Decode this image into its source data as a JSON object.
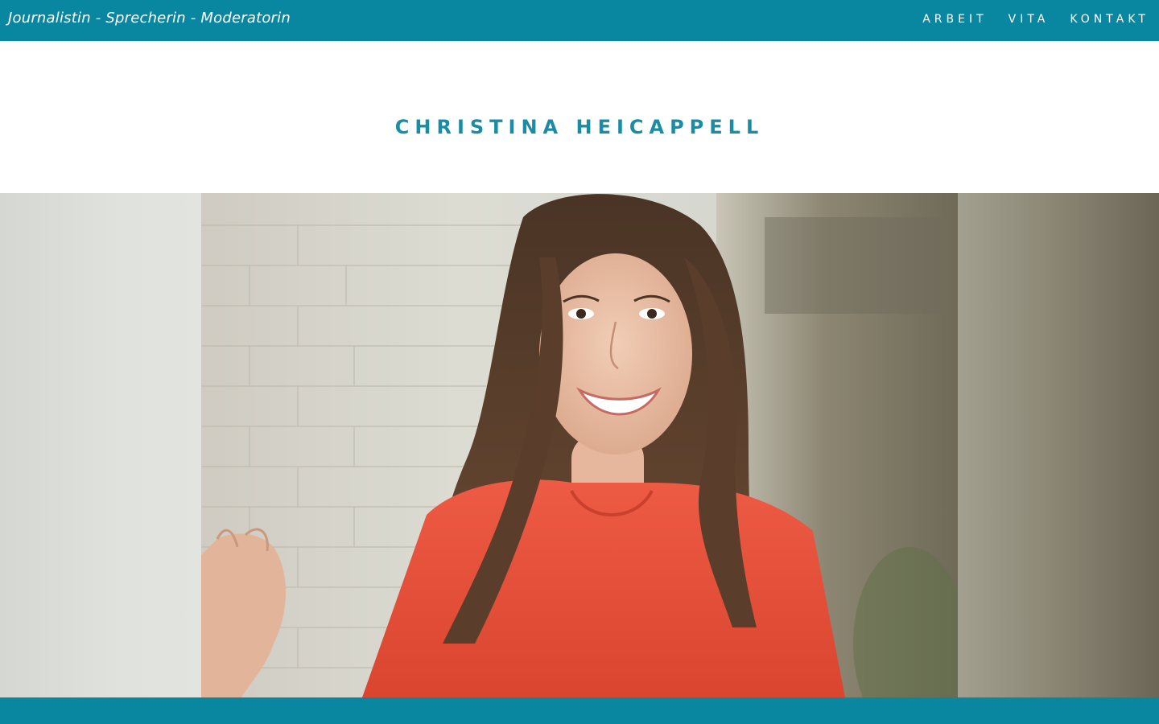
{
  "header": {
    "tagline": "Journalistin - Sprecherin - Moderatorin",
    "nav": [
      {
        "label": "ARBEIT"
      },
      {
        "label": "VITA"
      },
      {
        "label": "KONTAKT"
      }
    ]
  },
  "hero": {
    "title": "CHRISTINA HEICAPPELL",
    "photo_subject": "portrait-photo"
  },
  "colors": {
    "accent": "#0a87a0",
    "title": "#1a8ca3",
    "shirt": "#e8533f",
    "hair": "#5a3e2b"
  }
}
